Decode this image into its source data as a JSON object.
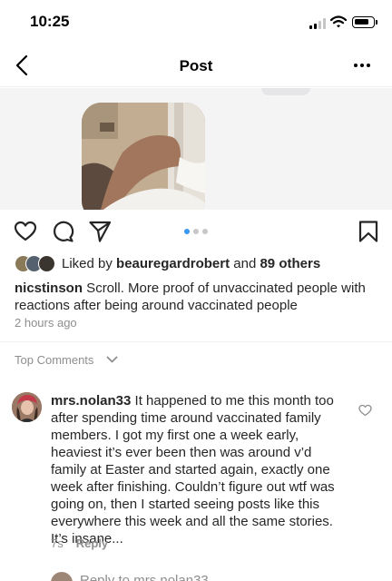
{
  "status_bar": {
    "time": "10:25"
  },
  "nav": {
    "title": "Post",
    "back_icon": "chevron-left-icon",
    "more_icon": "more-horizontal-icon"
  },
  "post": {
    "carousel": {
      "slide_count": 3,
      "active_index": 0
    },
    "actions": {
      "like_icon": "heart-icon",
      "comment_icon": "comment-icon",
      "share_icon": "send-icon",
      "save_icon": "bookmark-icon"
    },
    "likes": {
      "prefix": "Liked by ",
      "user": "beauregardrobert",
      "middle": " and ",
      "others": "89 others"
    },
    "caption": {
      "username": "nicstinson",
      "text": " Scroll.  More proof of unvaccinated people with reactions after being around vaccinated people"
    },
    "timestamp": "2 hours ago"
  },
  "comments": {
    "section_label": "Top Comments",
    "items": [
      {
        "username": "mrs.nolan33",
        "text": " It happened to me this month too after spending time around vaccinated family members. I got my first one a week early, heaviest it’s ever been then was around v’d family at Easter and started again, exactly one week after finishing. Couldn’t figure out wtf was going on, then I started seeing posts like this everywhere this week and all the same stories. It’s insane...",
        "age": "7s",
        "reply_label": "Reply"
      }
    ],
    "reply_prefix": "Reply to ",
    "reply_target": "mrs.nolan33"
  },
  "colors": {
    "accent": "#3897f0",
    "muted_text": "#8e8e8e",
    "primary_text": "#262626"
  }
}
